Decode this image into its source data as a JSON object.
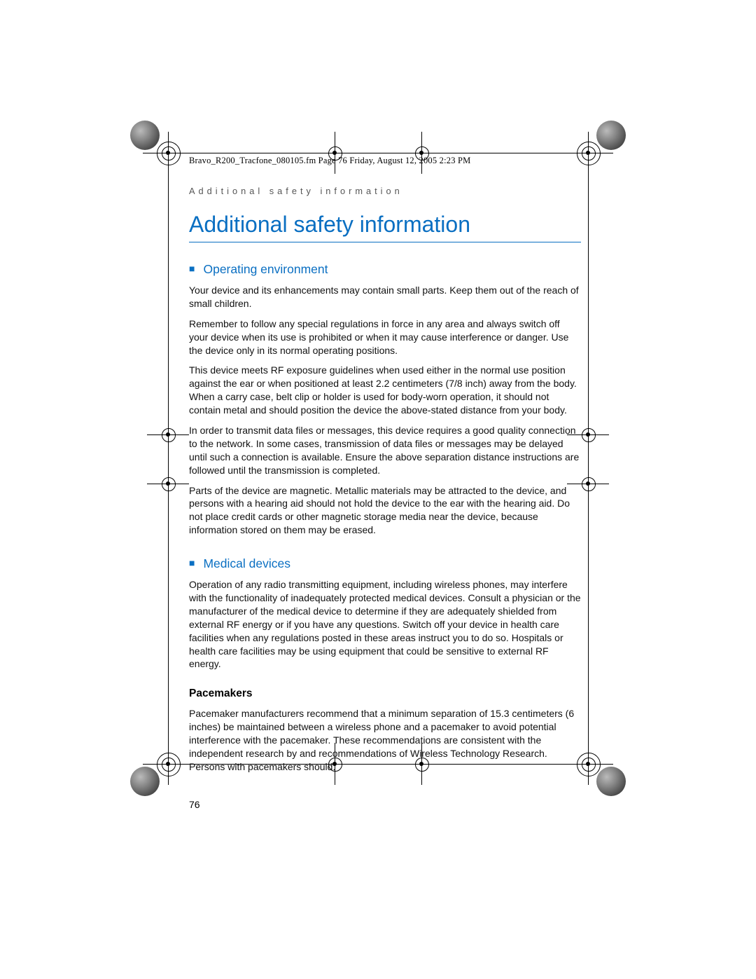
{
  "file_tag": "Bravo_R200_Tracfone_080105.fm  Page 76  Friday, August 12, 2005  2:23 PM",
  "running_head": "Additional safety information",
  "title": "Additional safety information",
  "sections": [
    {
      "heading": "Operating environment",
      "paragraphs": [
        "Your device and its enhancements may contain small parts. Keep them out of the reach of small children.",
        "Remember to follow any special regulations in force in any area and always switch off your device when its use is prohibited or when it may cause interference or danger. Use the device only in its normal operating positions.",
        "This device meets RF exposure guidelines when used either in the normal use position against the ear or when positioned at least 2.2 centimeters (7/8 inch) away from the body.  When a carry case, belt clip or holder is used for body-worn operation, it should not contain metal and should position the device the above-stated distance from your body.",
        "In order to transmit data files or messages, this device requires a good quality connection to the network. In some cases, transmission of data files or messages may be delayed until such a connection is available. Ensure the above separation distance instructions are followed until the transmission is completed.",
        "Parts of the device are magnetic. Metallic materials may be attracted to the device, and persons with a hearing aid should not hold the device to the ear with the hearing aid. Do not place credit cards or other magnetic storage media near the device, because information stored on them may be erased."
      ]
    },
    {
      "heading": "Medical devices",
      "paragraphs": [
        "Operation of any radio transmitting equipment, including wireless phones, may interfere with the functionality of inadequately protected medical devices. Consult a physician or the manufacturer of the medical device to determine if they are adequately shielded from external RF energy or if you have any questions. Switch off your device in health care facilities when any regulations posted in these areas instruct you to do so. Hospitals or health care facilities may be using equipment that could be sensitive to external RF energy."
      ],
      "subsections": [
        {
          "heading": "Pacemakers",
          "paragraphs": [
            "Pacemaker manufacturers recommend that a minimum separation of 15.3 centimeters (6 inches) be maintained between a wireless phone and a pacemaker to avoid potential interference with the pacemaker. These recommendations are consistent with the independent research by and recommendations of Wireless Technology Research. Persons with pacemakers should:"
          ]
        }
      ]
    }
  ],
  "page_number": "76"
}
